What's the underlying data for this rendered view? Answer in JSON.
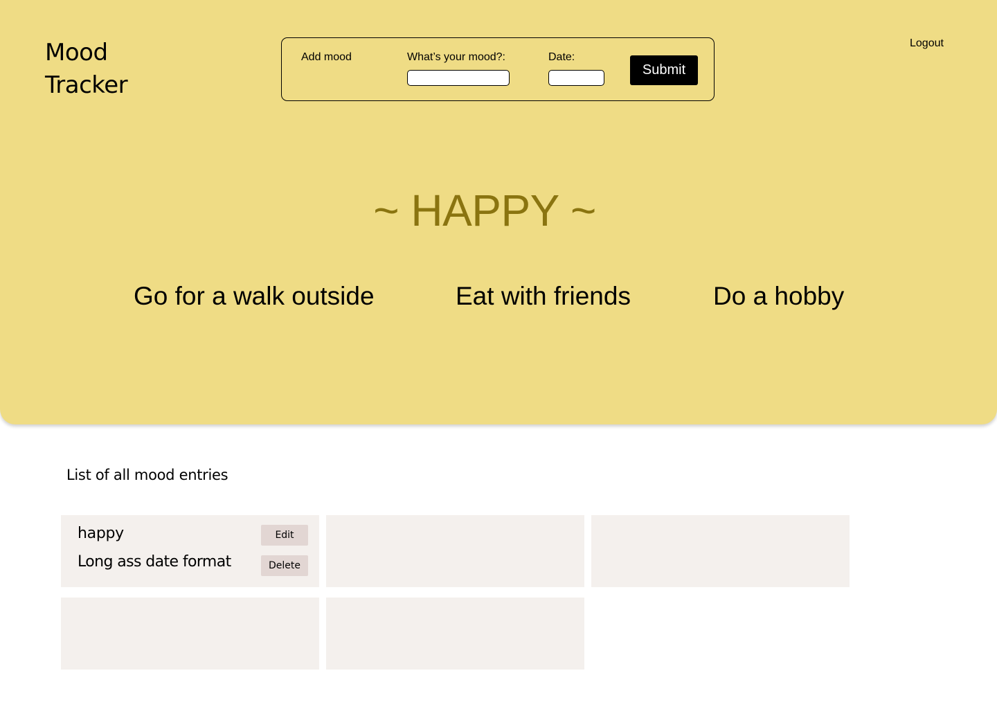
{
  "app": {
    "logo_line1": "Mood",
    "logo_line2": "Tracker",
    "logout_label": "Logout"
  },
  "add_form": {
    "title": "Add mood",
    "mood_label": "What’s your mood?:",
    "mood_value": "",
    "date_label": "Date:",
    "date_value": "",
    "submit_label": "Submit"
  },
  "current_mood": {
    "heading": "~ HAPPY ~",
    "suggestions": [
      "Go for a walk outside",
      "Eat with friends",
      "Do a hobby"
    ]
  },
  "entries_section": {
    "title": "List of all mood entries",
    "entries": [
      {
        "mood": "happy",
        "date": "Long ass date format",
        "edit_label": "Edit",
        "delete_label": "Delete"
      }
    ]
  },
  "colors": {
    "hero_background": "#efdc85",
    "mood_heading": "#8a7410",
    "card_background": "#f4f0ed",
    "entry_button": "#e2d6d3",
    "submit_button": "#000000"
  }
}
